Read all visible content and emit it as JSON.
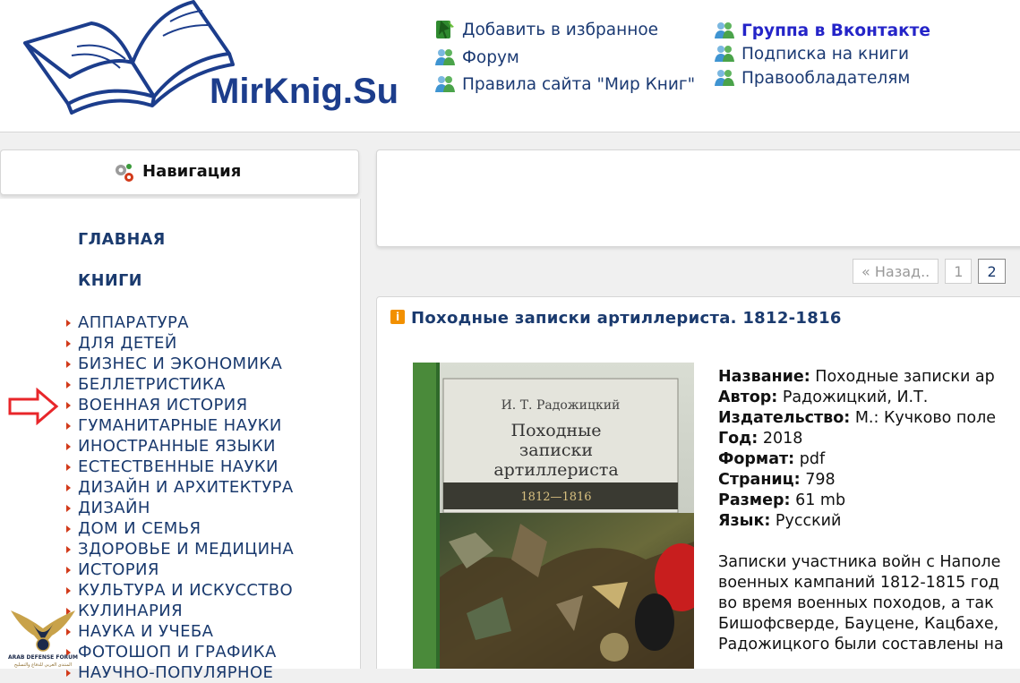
{
  "header": {
    "logo_text": "MirKnig.Su",
    "links_left": [
      {
        "label": "Добавить в избранное",
        "icon": "bookmark-icon"
      },
      {
        "label": "Форум",
        "icon": "users-icon"
      },
      {
        "label": "Правила сайта \"Мир Книг\"",
        "icon": "users-icon"
      }
    ],
    "links_right": [
      {
        "label": "Группа в Вконтакте",
        "icon": "users-icon",
        "bold": true
      },
      {
        "label": "Подписка на книги",
        "icon": "users-icon"
      },
      {
        "label": "Правообладателям",
        "icon": "users-icon"
      }
    ]
  },
  "sidebar": {
    "title": "Навигация",
    "main_links": [
      "ГЛАВНАЯ",
      "КНИГИ"
    ],
    "categories": [
      "АППАРАТУРА",
      "ДЛЯ ДЕТЕЙ",
      "БИЗНЕС И ЭКОНОМИКА",
      "БЕЛЛЕТРИСТИКА",
      "ВОЕННАЯ ИСТОРИЯ",
      "ГУМАНИТАРНЫЕ НАУКИ",
      "ИНОСТРАННЫЕ ЯЗЫКИ",
      "ЕСТЕСТВЕННЫЕ НАУКИ",
      "ДИЗАЙН И АРХИТЕКТУРА",
      "ДИЗАЙН",
      "ДОМ И СЕМЬЯ",
      "ЗДОРОВЬЕ И МЕДИЦИНА",
      "ИСТОРИЯ",
      "КУЛЬТУРА И ИСКУССТВО",
      "КУЛИНАРИЯ",
      "НАУКА И УЧЕБА",
      "ФОТОШОП И ГРАФИКА",
      "НАУЧНО-ПОПУЛЯРНОЕ"
    ]
  },
  "pagination": {
    "prev_label": "« Назад..",
    "pages": [
      "1",
      "2"
    ]
  },
  "article": {
    "title": "Походные записки артиллериста. 1812-1816",
    "cover": {
      "author": "И. Т. Радожицкий",
      "title_lines": [
        "Походные",
        "записки",
        "артиллериста"
      ],
      "years": "1812—1816"
    },
    "details": [
      {
        "label": "Название:",
        "value": " Походные записки ар"
      },
      {
        "label": "Автор:",
        "value": " Радожицкий, И.Т."
      },
      {
        "label": "Издательство:",
        "value": " М.: Кучково поле"
      },
      {
        "label": "Год:",
        "value": " 2018"
      },
      {
        "label": "Формат:",
        "value": " pdf"
      },
      {
        "label": "Страниц:",
        "value": " 798"
      },
      {
        "label": "Размер:",
        "value": " 61 mb"
      },
      {
        "label": "Язык:",
        "value": " Русский"
      }
    ],
    "description_lines": [
      "Записки участника войн с Наполе",
      "военных кампаний 1812-1815 год",
      "во время военных походов, а так",
      "Бишофсверде, Бауцене, Кацбахе,",
      "Радожицкого были составлены на"
    ]
  },
  "watermark": {
    "line1": "ARAB DEFENSE FORUM",
    "line2": "المنتدى العربي للدفاع والتسليح"
  },
  "colors": {
    "link": "#1a3a6e",
    "logo": "#1c3d8c",
    "arrow": "#e8262a",
    "bullet": "#d23a1a"
  }
}
